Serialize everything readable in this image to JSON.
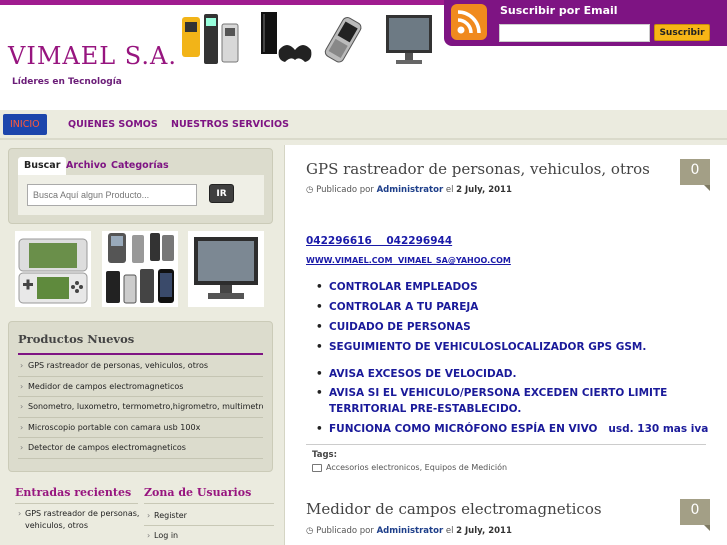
{
  "site": {
    "title": "VIMAEL S.A.",
    "tagline": "Líderes en Tecnología"
  },
  "subscribe": {
    "label": "Suscribir por Email",
    "button": "Suscribir",
    "value": ""
  },
  "nav": [
    {
      "label": "INICIO"
    },
    {
      "label": "QUIENES SOMOS"
    },
    {
      "label": "NUESTROS SERVICIOS"
    }
  ],
  "search": {
    "tabs": [
      "Buscar",
      "Archivo",
      "Categorías"
    ],
    "placeholder": "Busca Aquí algun Producto...",
    "button": "IR"
  },
  "products": {
    "title": "Productos Nuevos",
    "items": [
      "GPS rastreador de personas, vehiculos, otros",
      "Medidor de campos electromagneticos",
      "Sonometro, luxometro, termometro,higrometro, multimetro",
      "Microscopio portable con camara usb 100x",
      "Detector de campos electromagneticos"
    ]
  },
  "entradas": {
    "title": "Entradas recientes",
    "item": "GPS rastreador de personas, vehiculos, otros"
  },
  "zona": {
    "title": "Zona de Usuarios",
    "items": [
      "Register",
      "Log in"
    ]
  },
  "posts": [
    {
      "title": "GPS rastreador de personas, vehiculos, otros",
      "meta_prefix": "Publicado por ",
      "author": "Administrator",
      "meta_mid": " el ",
      "date": "2 July, 2011",
      "count": "0",
      "phones": "042296616    042296944",
      "web": "WWW.VIMAEL.COM  VIMAEL_SA@YAHOO.COM",
      "features": [
        "CONTROLAR EMPLEADOS",
        "CONTROLAR A TU PAREJA",
        "CUIDADO DE PERSONAS",
        "SEGUIMIENTO DE VEHICULOSLOCALIZADOR GPS GSM.",
        "AVISA EXCESOS DE VELOCIDAD.",
        "AVISA SI EL VEHICULO/PERSONA EXCEDEN CIERTO LIMITE TERRITORIAL PRE-ESTABLECIDO.",
        "FUNCIONA COMO MICRÓFONO ESPÍA EN VIVO   usd. 130 mas iva"
      ],
      "tags_label": "Tags:",
      "tags": "Accesorios electronicos, Equipos de Medición"
    },
    {
      "title": "Medidor de campos electromagneticos",
      "meta_prefix": "Publicado por ",
      "author": "Administrator",
      "meta_mid": " el ",
      "date": "2 July, 2011",
      "count": "0"
    }
  ],
  "colors": {
    "brand": "#97157f",
    "subscribe_bg": "#7e1483",
    "nav_active": "#1c45ac",
    "rss": "#f08a1e"
  }
}
